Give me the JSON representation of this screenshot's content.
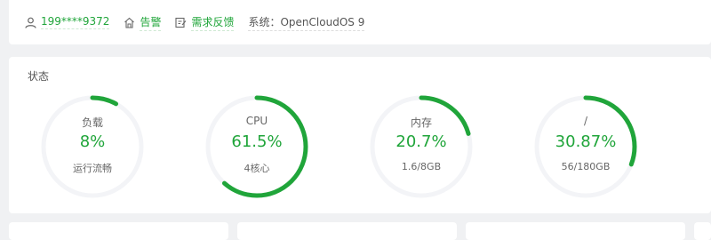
{
  "topbar": {
    "user": "199****9372",
    "alert_label": "告警",
    "feedback_label": "需求反馈",
    "system_text": "系统：OpenCloudOS 9"
  },
  "status": {
    "title": "状态",
    "gauges": [
      {
        "label": "负载",
        "value": "8%",
        "sub": "运行流畅",
        "fraction": 0.08
      },
      {
        "label": "CPU",
        "value": "61.5%",
        "sub": "4核心",
        "fraction": 0.615
      },
      {
        "label": "内存",
        "value": "20.7%",
        "sub": "1.6/8GB",
        "fraction": 0.207
      },
      {
        "label": "/",
        "value": "30.87%",
        "sub": "56/180GB",
        "fraction": 0.3087
      }
    ]
  },
  "colors": {
    "accent": "#20a53a",
    "track": "#f3f4f7"
  }
}
